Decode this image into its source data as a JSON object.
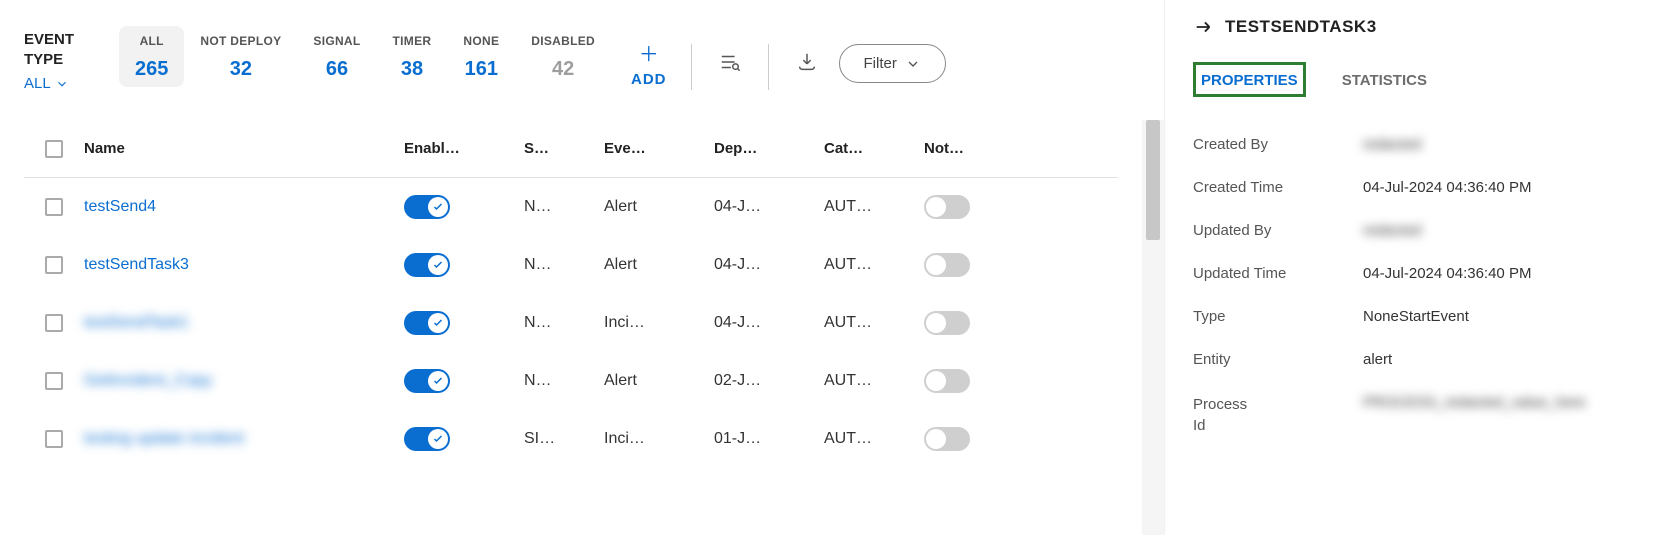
{
  "eventType": {
    "label1": "EVENT",
    "label2": "TYPE",
    "all_label": "ALL"
  },
  "counters": [
    {
      "label": "ALL",
      "value": "265",
      "selected": true,
      "disabled": false
    },
    {
      "label": "NOT DEPLOY",
      "value": "32",
      "selected": false,
      "disabled": false
    },
    {
      "label": "SIGNAL",
      "value": "66",
      "selected": false,
      "disabled": false
    },
    {
      "label": "TIMER",
      "value": "38",
      "selected": false,
      "disabled": false
    },
    {
      "label": "NONE",
      "value": "161",
      "selected": false,
      "disabled": false
    },
    {
      "label": "DISABLED",
      "value": "42",
      "selected": false,
      "disabled": true
    }
  ],
  "add_label": "ADD",
  "filter_label": "Filter",
  "columns": {
    "name": "Name",
    "enabl": "Enabl…",
    "s": "S…",
    "eve": "Eve…",
    "dep": "Dep…",
    "cat": "Cat…",
    "not": "Not…"
  },
  "rows": [
    {
      "name": "testSend4",
      "blur": false,
      "enabled": true,
      "s": "N…",
      "ev": "Alert",
      "dep": "04-J…",
      "cat": "AUT…",
      "not": false
    },
    {
      "name": "testSendTask3",
      "blur": false,
      "enabled": true,
      "s": "N…",
      "ev": "Alert",
      "dep": "04-J…",
      "cat": "AUT…",
      "not": false
    },
    {
      "name": "testSendTask1",
      "blur": true,
      "enabled": true,
      "s": "N…",
      "ev": "Inci…",
      "dep": "04-J…",
      "cat": "AUT…",
      "not": false
    },
    {
      "name": "GetIncident_Copy",
      "blur": true,
      "enabled": true,
      "s": "N…",
      "ev": "Alert",
      "dep": "02-J…",
      "cat": "AUT…",
      "not": false
    },
    {
      "name": "testing update incident",
      "blur": true,
      "enabled": true,
      "s": "SI…",
      "ev": "Inci…",
      "dep": "01-J…",
      "cat": "AUT…",
      "not": false
    }
  ],
  "side": {
    "title": "TESTSENDTASK3",
    "tabs": {
      "properties": "PROPERTIES",
      "statistics": "STATISTICS"
    },
    "properties": [
      {
        "label": "Created By",
        "value": "redacted",
        "blur": true
      },
      {
        "label": "Created Time",
        "value": "04-Jul-2024 04:36:40 PM",
        "blur": false
      },
      {
        "label": "Updated By",
        "value": "redacted",
        "blur": true
      },
      {
        "label": "Updated Time",
        "value": "04-Jul-2024 04:36:40 PM",
        "blur": false
      },
      {
        "label": "Type",
        "value": "NoneStartEvent",
        "blur": false
      },
      {
        "label": "Entity",
        "value": "alert",
        "blur": false
      },
      {
        "label": "Process Id",
        "value": "PROCESS_redacted_value_here",
        "blur": true,
        "multi": true
      }
    ]
  }
}
